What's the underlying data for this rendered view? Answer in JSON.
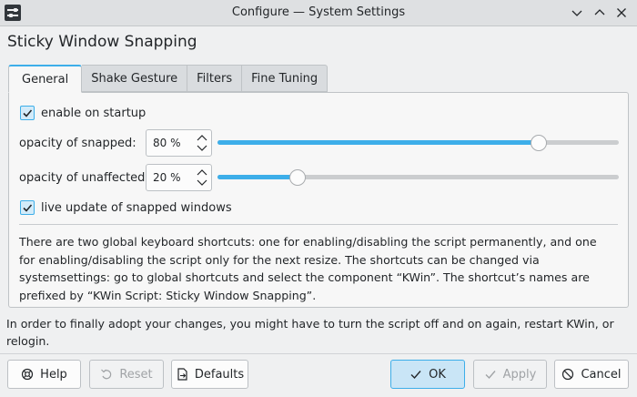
{
  "window": {
    "title": "Configure — System Settings"
  },
  "page": {
    "title": "Sticky Window Snapping"
  },
  "tabs": [
    {
      "label": "General",
      "active": true
    },
    {
      "label": "Shake Gesture",
      "active": false
    },
    {
      "label": "Filters",
      "active": false
    },
    {
      "label": "Fine Tuning",
      "active": false
    }
  ],
  "general": {
    "enable_on_startup": {
      "label": "enable on startup",
      "checked": true
    },
    "opacity_snapped": {
      "label": "opacity of snapped:",
      "value": "80 %",
      "percent": 80
    },
    "opacity_unaffected": {
      "label": "opacity of unaffected:",
      "value": "20 %",
      "percent": 20
    },
    "live_update": {
      "label": "live update of snapped windows",
      "checked": true
    },
    "description": "There are two global keyboard shortcuts: one for enabling/disabling the script permanently, and one for enabling/disabling the script only for the next resize. The shortcuts can be changed via systemsettings: go to global shortcuts and select the component “KWin”. The shortcut’s names are prefixed by “KWin Script: Sticky Window Snapping”."
  },
  "note": "In order to finally adopt your changes, you might have to turn the script off and on again, restart KWin, or relogin.",
  "buttons": {
    "help": "Help",
    "reset": "Reset",
    "defaults": "Defaults",
    "ok": "OK",
    "apply": "Apply",
    "cancel": "Cancel"
  },
  "colors": {
    "accent": "#3daee9",
    "window_bg": "#eff0f1",
    "panel_bg": "#f7f7f7"
  }
}
